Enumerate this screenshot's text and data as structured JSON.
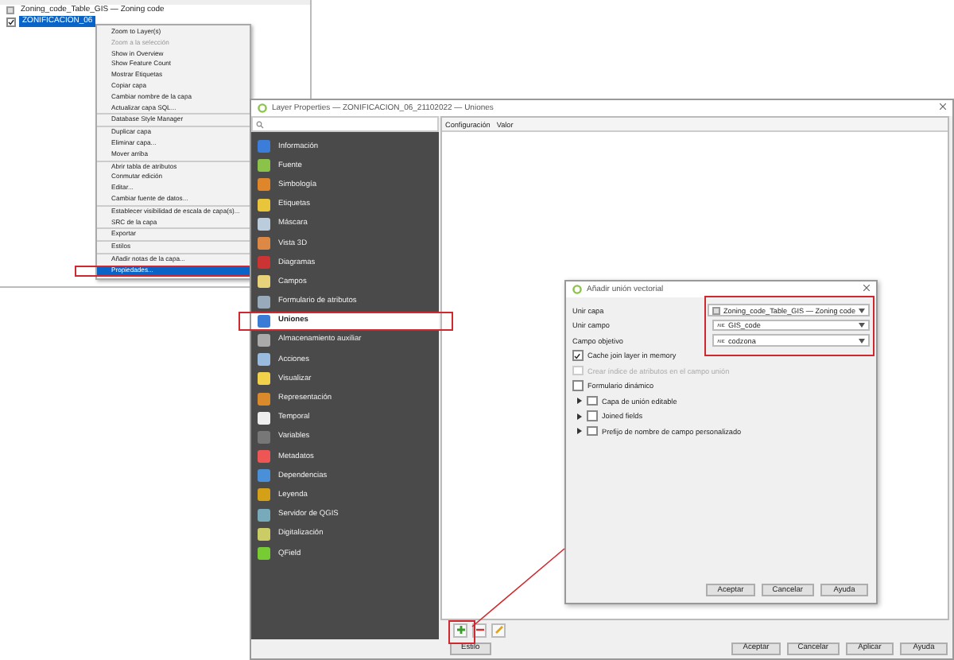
{
  "layers_panel": {
    "layers": [
      {
        "name": "Zoning_code_Table_GIS — Zoning code",
        "kind": "table",
        "selected": false
      },
      {
        "name": "ZONIFICACION_06",
        "kind": "vector",
        "selected": true,
        "checked": true
      }
    ]
  },
  "context_menu": {
    "items": [
      {
        "label": "Zoom to Layer(s)",
        "disabled": false,
        "selected": false,
        "separator_after": false,
        "highlighted": false
      },
      {
        "label": "Zoom a la selección",
        "disabled": true,
        "selected": false,
        "separator_after": false,
        "highlighted": false
      },
      {
        "label": "Show in Overview",
        "disabled": false,
        "selected": false,
        "separator_after": false,
        "highlighted": false
      },
      {
        "label": "Show Feature Count",
        "disabled": false,
        "selected": false,
        "separator_after": false,
        "highlighted": false
      },
      {
        "label": "Mostrar Etiquetas",
        "disabled": false,
        "selected": false,
        "separator_after": false,
        "highlighted": false
      },
      {
        "label": "Copiar capa",
        "disabled": false,
        "selected": false,
        "separator_after": false,
        "highlighted": false
      },
      {
        "label": "Cambiar nombre de la capa",
        "disabled": false,
        "selected": false,
        "separator_after": false,
        "highlighted": false
      },
      {
        "label": "Actualizar capa SQL...",
        "disabled": false,
        "selected": false,
        "separator_after": true,
        "highlighted": false
      },
      {
        "label": "Database Style Manager",
        "disabled": false,
        "selected": false,
        "separator_after": true,
        "highlighted": false
      },
      {
        "label": "Duplicar capa",
        "disabled": false,
        "selected": false,
        "separator_after": false,
        "highlighted": false
      },
      {
        "label": "Eliminar capa...",
        "disabled": false,
        "selected": false,
        "separator_after": false,
        "highlighted": false
      },
      {
        "label": "Mover arriba",
        "disabled": false,
        "selected": false,
        "separator_after": true,
        "highlighted": false
      },
      {
        "label": "Abrir tabla de atributos",
        "disabled": false,
        "selected": false,
        "separator_after": false,
        "highlighted": false
      },
      {
        "label": "Conmutar edición",
        "disabled": false,
        "selected": false,
        "separator_after": false,
        "highlighted": false
      },
      {
        "label": "Editar...",
        "disabled": false,
        "selected": false,
        "separator_after": false,
        "highlighted": false
      },
      {
        "label": "Cambiar fuente de datos...",
        "disabled": false,
        "selected": false,
        "separator_after": true,
        "highlighted": false
      },
      {
        "label": "Establecer visibilidad de escala de capa(s)...",
        "disabled": false,
        "selected": false,
        "separator_after": false,
        "highlighted": false
      },
      {
        "label": "SRC de la capa",
        "disabled": false,
        "selected": false,
        "separator_after": true,
        "highlighted": false
      },
      {
        "label": "Exportar",
        "disabled": false,
        "selected": false,
        "separator_after": true,
        "highlighted": false
      },
      {
        "label": "Estilos",
        "disabled": false,
        "selected": false,
        "separator_after": true,
        "highlighted": false
      },
      {
        "label": "Añadir notas de la capa...",
        "disabled": false,
        "selected": false,
        "separator_after": false,
        "highlighted": false
      },
      {
        "label": "Propiedades...",
        "disabled": false,
        "selected": true,
        "separator_after": false,
        "highlighted": true
      }
    ]
  },
  "layer_properties": {
    "title": "Layer Properties — ZONIFICACION_06_21102022 — Uniones",
    "sidebar": {
      "items": [
        {
          "label": "Información",
          "selected": false,
          "highlighted": false
        },
        {
          "label": "Fuente",
          "selected": false,
          "highlighted": false
        },
        {
          "label": "Simbología",
          "selected": false,
          "highlighted": false
        },
        {
          "label": "Etiquetas",
          "selected": false,
          "highlighted": false
        },
        {
          "label": "Máscara",
          "selected": false,
          "highlighted": false
        },
        {
          "label": "Vista 3D",
          "selected": false,
          "highlighted": false
        },
        {
          "label": "Diagramas",
          "selected": false,
          "highlighted": false
        },
        {
          "label": "Campos",
          "selected": false,
          "highlighted": false
        },
        {
          "label": "Formulario de atributos",
          "selected": false,
          "highlighted": false
        },
        {
          "label": "Uniones",
          "selected": true,
          "highlighted": true
        },
        {
          "label": "Almacenamiento auxiliar",
          "selected": false,
          "highlighted": false
        },
        {
          "label": "Acciones",
          "selected": false,
          "highlighted": false
        },
        {
          "label": "Visualizar",
          "selected": false,
          "highlighted": false
        },
        {
          "label": "Representación",
          "selected": false,
          "highlighted": false
        },
        {
          "label": "Temporal",
          "selected": false,
          "highlighted": false
        },
        {
          "label": "Variables",
          "selected": false,
          "highlighted": false
        },
        {
          "label": "Metadatos",
          "selected": false,
          "highlighted": false
        },
        {
          "label": "Dependencias",
          "selected": false,
          "highlighted": false
        },
        {
          "label": "Leyenda",
          "selected": false,
          "highlighted": false
        },
        {
          "label": "Servidor de QGIS",
          "selected": false,
          "highlighted": false
        },
        {
          "label": "Digitalización",
          "selected": false,
          "highlighted": false
        },
        {
          "label": "QField",
          "selected": false,
          "highlighted": false
        }
      ]
    },
    "table": {
      "columns": [
        "Configuración",
        "Valor"
      ]
    },
    "style_button": "Estilo",
    "buttons": [
      "Aceptar",
      "Cancelar",
      "Aplicar",
      "Ayuda"
    ]
  },
  "join_dialog": {
    "title": "Añadir unión vectorial",
    "fields": [
      {
        "label": "Unir capa",
        "value": "Zoning_code_Table_GIS — Zoning code",
        "kind": "layer"
      },
      {
        "label": "Unir campo",
        "value": "GIS_code",
        "kind": "field"
      },
      {
        "label": "Campo objetivo",
        "value": "codzona",
        "kind": "field"
      }
    ],
    "options": [
      {
        "label": "Cache join layer in memory",
        "checked": true,
        "disabled": false,
        "kind": "checkbox"
      },
      {
        "label": "Crear índice de atributos en el campo unión",
        "checked": false,
        "disabled": true,
        "kind": "checkbox"
      },
      {
        "label": "Formulario dinámico",
        "checked": false,
        "disabled": false,
        "kind": "checkbox"
      },
      {
        "label": "Capa de unión editable",
        "checked": false,
        "disabled": false,
        "kind": "group"
      },
      {
        "label": "Joined fields",
        "checked": false,
        "disabled": false,
        "kind": "group"
      },
      {
        "label": "Prefijo de nombre de campo personalizado",
        "checked": false,
        "disabled": false,
        "kind": "group"
      }
    ],
    "buttons": [
      "Aceptar",
      "Cancelar",
      "Ayuda"
    ]
  }
}
